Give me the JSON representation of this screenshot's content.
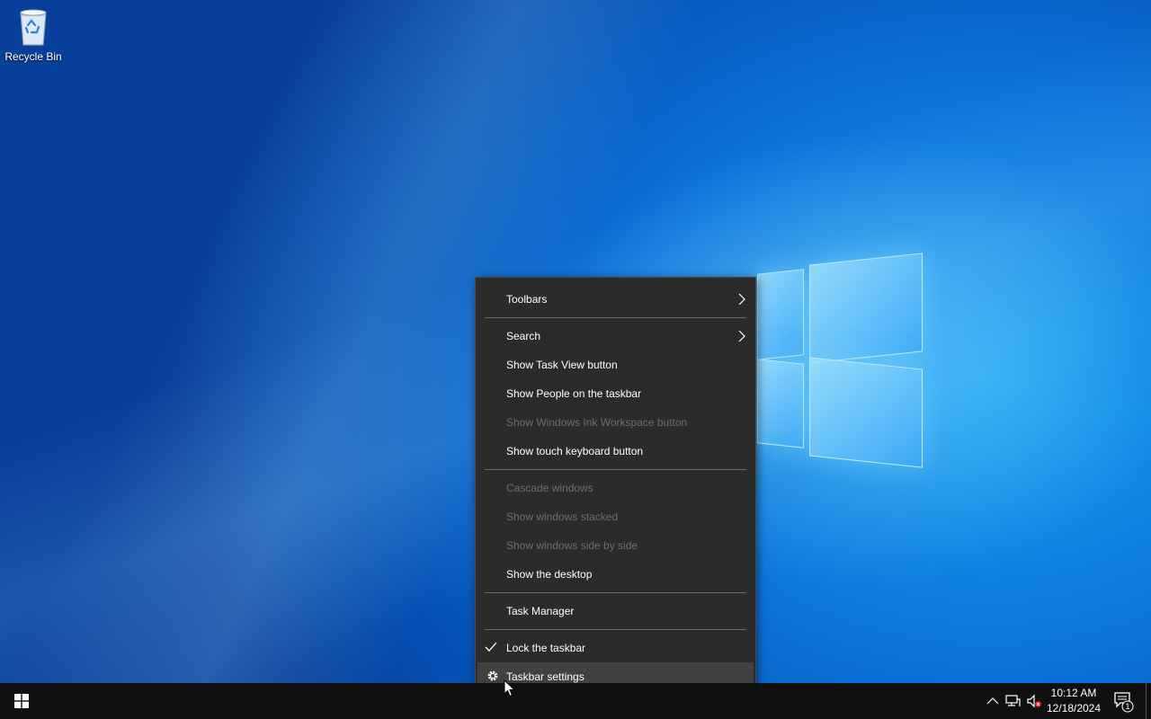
{
  "desktop": {
    "icons": [
      {
        "label": "Recycle Bin",
        "icon": "recycle-bin-icon"
      }
    ]
  },
  "context_menu": {
    "items": [
      {
        "label": "Toolbars",
        "enabled": true,
        "submenu": true
      },
      {
        "label": "Search",
        "enabled": true,
        "submenu": true
      },
      {
        "label": "Show Task View button",
        "enabled": true
      },
      {
        "label": "Show People on the taskbar",
        "enabled": true
      },
      {
        "label": "Show Windows Ink Workspace button",
        "enabled": false
      },
      {
        "label": "Show touch keyboard button",
        "enabled": true
      },
      {
        "label": "Cascade windows",
        "enabled": false
      },
      {
        "label": "Show windows stacked",
        "enabled": false
      },
      {
        "label": "Show windows side by side",
        "enabled": false
      },
      {
        "label": "Show the desktop",
        "enabled": true
      },
      {
        "label": "Task Manager",
        "enabled": true
      },
      {
        "label": "Lock the taskbar",
        "enabled": true,
        "checked": true
      },
      {
        "label": "Taskbar settings",
        "enabled": true,
        "icon": "gear-icon",
        "highlighted": true
      }
    ]
  },
  "taskbar": {
    "start_icon": "windows-start-icon",
    "tray_icons": [
      "chevron-up-icon",
      "network-icon",
      "volume-muted-icon"
    ],
    "clock": {
      "time": "10:12 AM",
      "date": "12/18/2024"
    },
    "notification_count": "1"
  },
  "colors": {
    "menu_bg": "#2b2b2b",
    "menu_text": "#ffffff",
    "menu_disabled_text": "#6d6d6d",
    "menu_highlight": "#414141",
    "taskbar_bg": "#101010",
    "desktop_accent": "#0a64c8"
  }
}
